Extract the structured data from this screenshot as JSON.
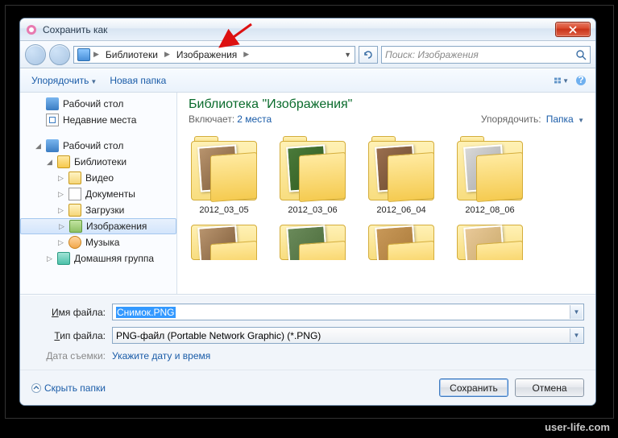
{
  "window": {
    "title": "Сохранить как"
  },
  "breadcrumb": {
    "root": "Библиотеки",
    "current": "Изображения"
  },
  "search": {
    "placeholder": "Поиск: Изображения"
  },
  "toolbar": {
    "organize": "Упорядочить",
    "new_folder": "Новая папка"
  },
  "sidebar": {
    "desktop": "Рабочий стол",
    "recent": "Недавние места",
    "desktop2": "Рабочий стол",
    "libraries": "Библиотеки",
    "video": "Видео",
    "documents": "Документы",
    "downloads": "Загрузки",
    "images": "Изображения",
    "music": "Музыка",
    "homegroup": "Домашняя группа"
  },
  "library": {
    "title": "Библиотека \"Изображения\"",
    "includes_label": "Включает:",
    "includes_link": "2 места",
    "arrange_label": "Упорядочить:",
    "arrange_value": "Папка"
  },
  "folders": [
    {
      "name": "2012_03_05"
    },
    {
      "name": "2012_03_06"
    },
    {
      "name": "2012_06_04"
    },
    {
      "name": "2012_08_06"
    }
  ],
  "fields": {
    "filename_label": "Имя файла:",
    "filename_value": "Снимок.PNG",
    "filetype_label": "Тип файла:",
    "filetype_value": "PNG-файл (Portable Network Graphic) (*.PNG)",
    "date_label": "Дата съемки:",
    "date_link": "Укажите дату и время"
  },
  "footer": {
    "hide_folders": "Скрыть папки",
    "save": "Сохранить",
    "cancel": "Отмена"
  },
  "watermark": "user-life.com"
}
